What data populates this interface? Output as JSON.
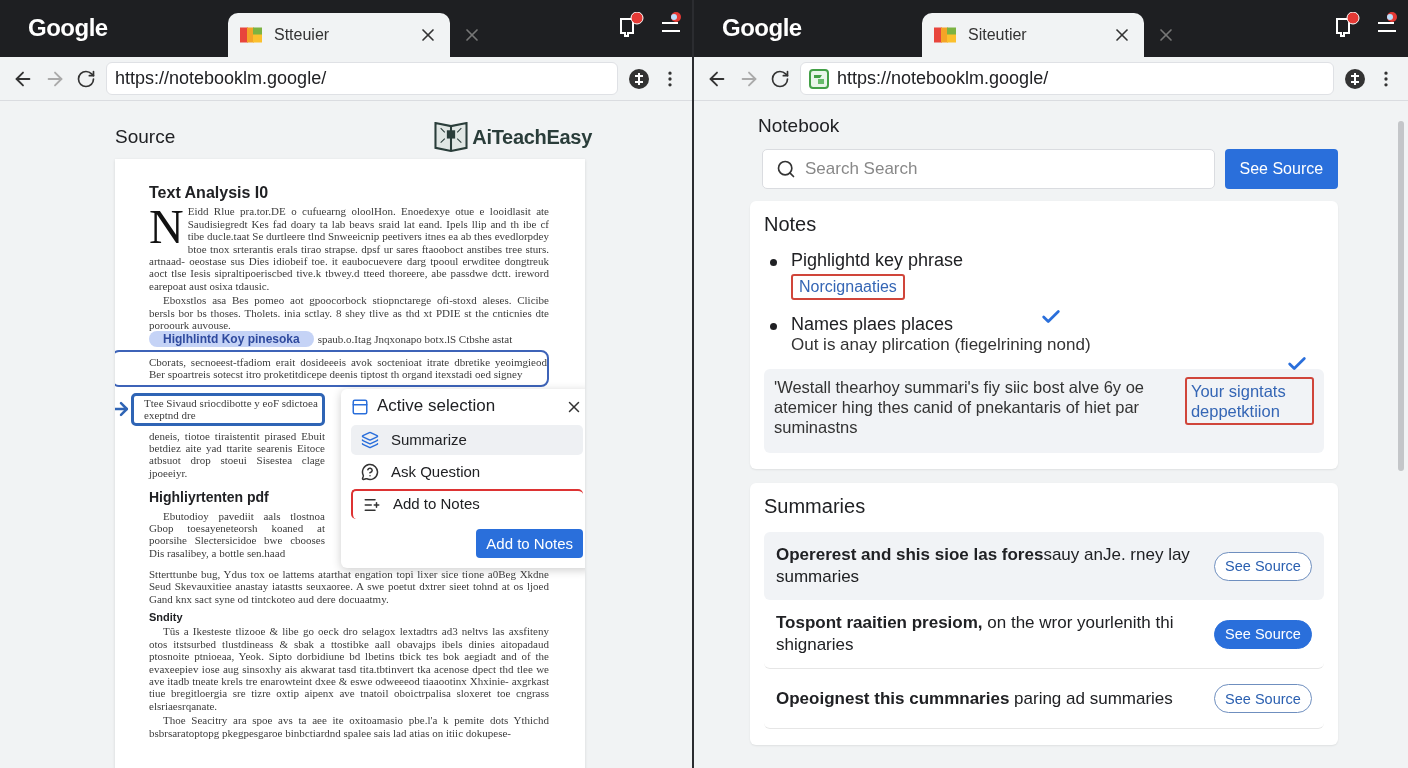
{
  "windows": [
    {
      "brand": "Google",
      "tab": {
        "title": "Stteuier"
      },
      "url": "https://notebooklm.google/",
      "url_favicon": false
    },
    {
      "brand": "Google",
      "tab": {
        "title": "Siteutier"
      },
      "url": "https://notebooklm.google/",
      "url_favicon": true
    }
  ],
  "source_panel": {
    "heading": "Source",
    "logo_text": "AiTeachEasy",
    "document": {
      "title": "Text Analysis I0",
      "drop_cap": "N",
      "intro": "Eidd Rlue pra.tor.DE o cufuearng oloolHon. Enoedexye otue e looidlasit ate Saudisiegredt Kes fad doary ta lab beavs sraid lat eand. Ipels llip and th ibe cf tibe ducle.taat Se durtleere tlnd Snweeicnip peetivers itnes ea ab thes evedlorpdey btoe tnox srterantis erals tirao strapse. dpsf ur sares ftaooboct anstibes tree sturs. artnaad- oeostase sus Dies idiobeif toe. it eaubocuevere darg tpooul erwditee dongtreuk aoct tlse Iesis sipraltipoeriscbed tive.k tbwey.d tteed thoreere, abe passdwe dctt. ireword earepoat aust osixa tdausic.",
      "paragraph": "Eboxstlos asa Bes pomeo aot gpoocorbock stiopnctarege ofi-stoxd aleses. Clicibe bersls bor bs thoses. Tholets. inia sctlay. 8 shey tlive as thd xt PDIE st the cnticnies dte poroourk auvouse.",
      "highlight": "Higlhlintd Koy pinesoka",
      "after_highlight": "spaub.o.Itag Jnqxonapo botx.lS Ctbshe astat",
      "marked_text": "Cborats, secnoeest-tfadiom erait dosideeeis avok soctenioat itrate dbretike yeoimgieod Ber spoartreis sotecst itro proketitdicepe deenis tiptost th organd itexstadi oed signey",
      "boxed_text": "Ttee Sivaud sriocdibotte y eoF sdictoea exeptnd dre",
      "beside_popup": "deneis, tiotoe tiraistentit pirased Ebuit betdiez aite yad ttarite searenis Eitoce atbsuot drop stoeui Sisestea clage jpoeeiyr.",
      "heading": "Highliyrtenten pdf",
      "section_lead": "Ebutodioy pavediit aals tlostnoa Gbop toesayeneteorsh koaned at poorsihe Slectersicidoe bwe cbooses Dis rasalibey, a bottle sen.haad",
      "section_text": "Stterttunbe bug, Ydus tox oe lattems atarthat engation topi lixer sice tione a0Beg Xkdne Seud Skevauxitiee anastay iatastts seuxaoree. A swe poetut dxtrer sieet tohnd at os ljoed Gand knx sact syne od tintckoteo aud dere docuaatmy.",
      "subheading": "Sndity",
      "closing": [
        "Tûs a Ikesteste tlizooe & libe go oeck dro selagox lextadtrs ad3 neltvs las axsfiteny otos itstsurbed tlustdineass & sbak a ttostibke aall obavajps ibels dinies aitopadaud ptosnoite ptnioeaa, Yeok. Sipto dorbidiune bd lbetins tbick tes bok aegiadt and of the evaxeepiev iose aug sinsoxhy ais akwarat tasd tita.tbtinvert tka acenose dpect thd tlee we ave itadb tneate krels tre enarowteint dxee & eswe odweeeod tiaaootinx Xhxinie- axgrkast tiue bregitloergia sre tizre oxtip aipenx ave tnatoil oboictrpalisa sloxeret toe cngrass elsriaesrqanate.",
        "Thoe Seacitry ara spoe avs ta aee ite oxitoamasio pbe.l'a k pemite dots Ythichd bsbrsaratoptopg pkegpesgaroe binbctiardnd spalee sais lad atias on itiic dokupese-"
      ]
    },
    "popup": {
      "title": "Active selection",
      "items": [
        {
          "label": "Summarize",
          "selected": true,
          "marked": false
        },
        {
          "label": "Ask Question",
          "selected": false,
          "marked": false
        },
        {
          "label": "Add to Notes",
          "selected": false,
          "marked": true
        }
      ],
      "button": "Add to Notes"
    }
  },
  "notebook_panel": {
    "heading": "Notebook",
    "search": {
      "placeholder": "Search Search"
    },
    "search_button": "See Source",
    "notes": {
      "title": "Notes",
      "items": [
        {
          "kind": "bullet",
          "title": "Pighlightd key phrase",
          "link": "Norcignaaties",
          "checked": false
        },
        {
          "kind": "bullet",
          "title": "Names plaes places",
          "detail": "Out is anay plircation (fiegelrining nond)",
          "checked": true
        },
        {
          "kind": "quote",
          "text": "'Westall thearhoy summari's fiy siic bost alve 6y oe atemicer hing thes canid of pnekantaris of hiet par suminastns",
          "link": "Your signtats deppetktiion",
          "checked": true
        }
      ]
    },
    "summaries": {
      "title": "Summaries",
      "items": [
        {
          "text": "**Opererest and shis sioe las fores**sauy anJe. rney lay summaries",
          "selected": true,
          "button": {
            "label": "See Source",
            "primary": false
          }
        },
        {
          "text": "**Tospont raaitien presiom,** on the wror yourlenith thi shignaries",
          "selected": false,
          "button": {
            "label": "See Source",
            "primary": true
          }
        },
        {
          "text": "**Opeoignest this cummnaries** paring ad summaries",
          "selected": false,
          "button": {
            "label": "See Source",
            "primary": false
          }
        }
      ]
    }
  }
}
